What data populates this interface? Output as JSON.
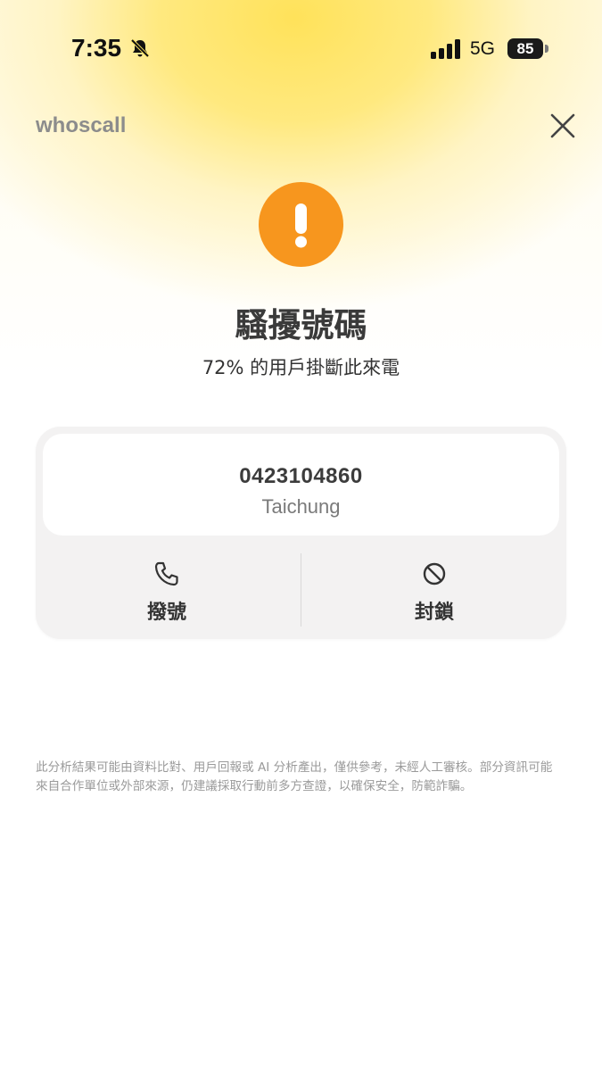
{
  "status_bar": {
    "time": "7:35",
    "network": "5G",
    "battery": "85"
  },
  "header": {
    "logo": "whoscall",
    "close_icon": "close-icon"
  },
  "result": {
    "icon": "exclamation-icon",
    "icon_color": "#f7961e",
    "title": "騷擾號碼",
    "subtitle": "72% 的用戶掛斷此來電"
  },
  "caller": {
    "number": "0423104860",
    "location": "Taichung"
  },
  "actions": {
    "call_label": "撥號",
    "call_icon": "phone-icon",
    "block_label": "封鎖",
    "block_icon": "block-icon"
  },
  "disclaimer": "此分析結果可能由資料比對、用戶回報或 AI 分析產出，僅供參考，未經人工審核。部分資訊可能來自合作單位或外部來源，仍建議採取行動前多方查證，以確保安全，防範詐騙。"
}
